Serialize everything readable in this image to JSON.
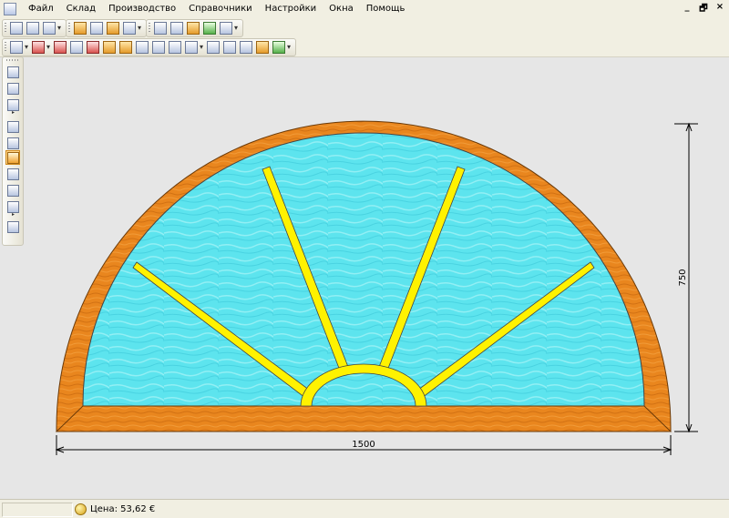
{
  "menu": {
    "items": [
      "Файл",
      "Склад",
      "Производство",
      "Справочники",
      "Настройки",
      "Окна",
      "Помощь"
    ],
    "window_controls": [
      "_",
      "🗗",
      "×"
    ]
  },
  "drawing": {
    "width_dim": "1500",
    "height_dim": "750",
    "colors": {
      "frame": "#e9861e",
      "frame_dark": "#b35c0a",
      "glass": "#5de4ee",
      "glass_light": "#a8f4f7",
      "mullion": "#fff200",
      "dim_line": "#000000"
    }
  },
  "status": {
    "price": "Цена: 53,62 €"
  },
  "icons": {
    "toolbar1": [
      "new-doc-icon",
      "open-doc-icon",
      "print-icon",
      "cube-icon",
      "product-icon",
      "lock-icon",
      "truck-icon",
      "grid-icon",
      "copy-icon",
      "table-icon",
      "chart-icon",
      "text-icon"
    ],
    "toolbar2": [
      "frame-icon",
      "profile-icon",
      "delete-icon",
      "split-icon",
      "merge-icon",
      "node-icon",
      "align-icon",
      "column-icon",
      "row-icon",
      "divide-icon",
      "layout-icon",
      "cells-icon",
      "export-icon",
      "edit-icon"
    ],
    "left": [
      "save-icon",
      "view-icon",
      "layers-icon",
      "properties-icon",
      "hand-icon",
      "move-icon",
      "undo-icon",
      "redo-icon",
      "zoom-icon",
      "measure-icon"
    ]
  }
}
